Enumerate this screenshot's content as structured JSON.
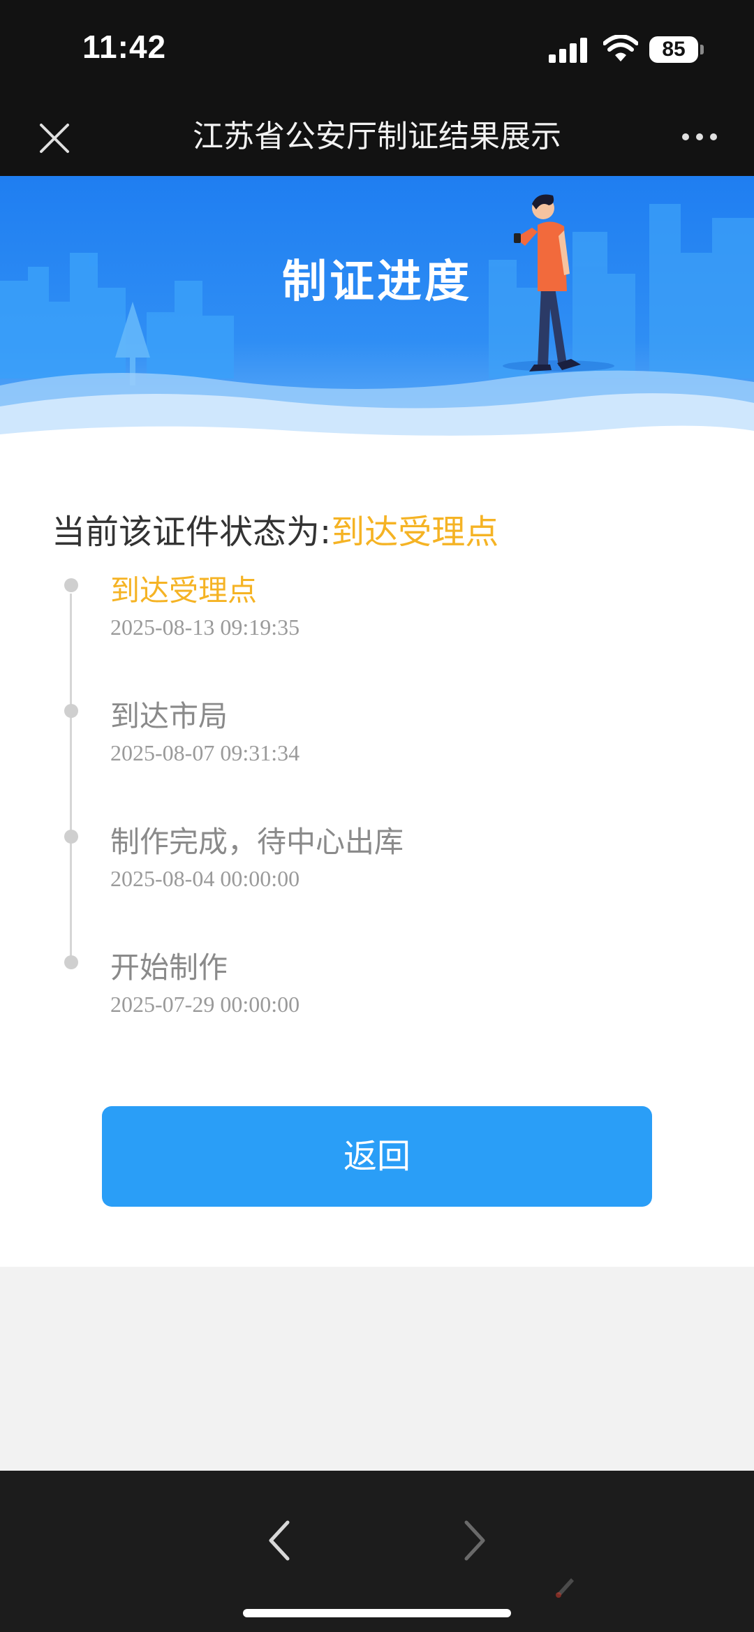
{
  "status_bar": {
    "time": "11:42",
    "battery": "85",
    "icons": [
      "signal-icon",
      "wifi-icon",
      "battery-icon"
    ]
  },
  "nav": {
    "title": "江苏省公安厅制证结果展示",
    "close_icon": "close-icon",
    "more_icon": "more-icon"
  },
  "banner": {
    "title": "制证进度"
  },
  "status": {
    "prefix": "当前该证件状态为:",
    "current": "到达受理点"
  },
  "timeline": [
    {
      "label": "到达受理点",
      "time": "2025-08-13 09:19:35",
      "active": true
    },
    {
      "label": "到达市局",
      "time": "2025-08-07 09:31:34",
      "active": false
    },
    {
      "label": "制作完成，待中心出库",
      "time": "2025-08-04 00:00:00",
      "active": false
    },
    {
      "label": "开始制作",
      "time": "2025-07-29 00:00:00",
      "active": false
    }
  ],
  "actions": {
    "back_label": "返回"
  },
  "browser_toolbar": {
    "back_icon": "chevron-left-icon",
    "forward_icon": "chevron-right-icon"
  },
  "colors": {
    "accent": "#f5b324",
    "primary_button": "#2a9ef7",
    "banner_blue": "#1f7ef1"
  }
}
